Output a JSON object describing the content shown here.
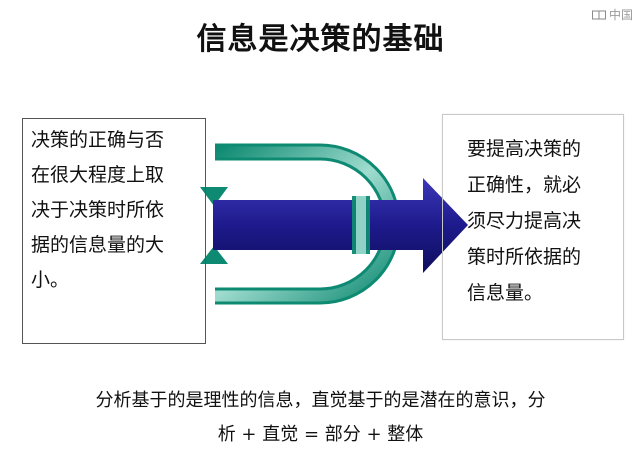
{
  "watermark": {
    "text": "中国",
    "icon": "book-logo-icon"
  },
  "title": "信息是决策的基础",
  "left_box": {
    "text": "决策的正确与否\n在很大程度上取\n决于决策时所依\n据的信息量的大\n小。"
  },
  "right_box": {
    "text": "要提高决策的\n正确性，就必\n须尽力提高决\n策时所依据的\n信息量。"
  },
  "caption": {
    "line1": "分析基于的是理性的信息，直觉基于的是潜在的意识，分",
    "line2": "析 + 直觉 = 部分 + 整体"
  },
  "colors": {
    "arrow_blue": "#1d1a8c",
    "loop_teal": "#1f9c84",
    "loop_light": "#bfe6dc"
  }
}
